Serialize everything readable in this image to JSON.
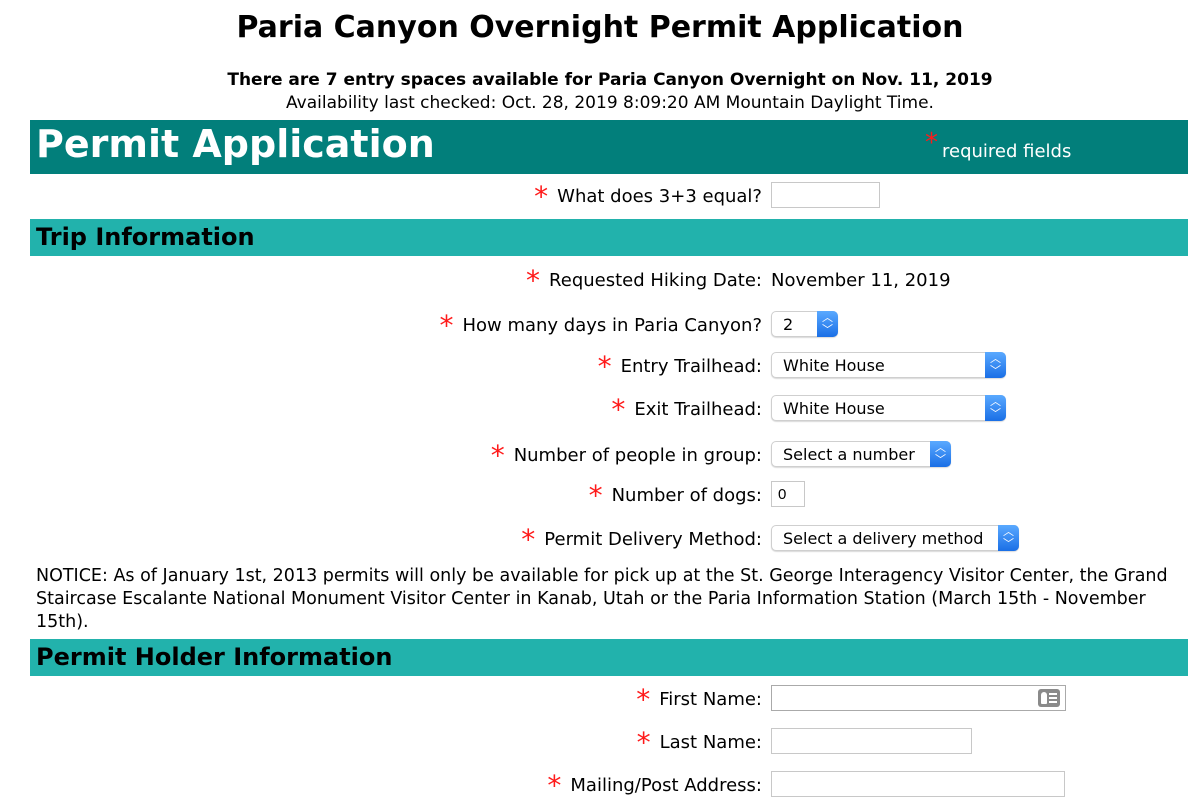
{
  "page": {
    "title": "Paria Canyon Overnight Permit Application",
    "availability": "There are 7 entry spaces available for Paria Canyon Overnight on Nov. 11, 2019",
    "last_checked": "Availability last checked: Oct. 28, 2019 8:09:20 AM Mountain Daylight Time."
  },
  "header": {
    "title": "Permit Application",
    "required_star": "*",
    "required_text": "required fields"
  },
  "captcha": {
    "label": "What does 3+3 equal?",
    "value": ""
  },
  "trip": {
    "title": "Trip Information",
    "hiking_date_label": "Requested Hiking Date:",
    "hiking_date_value": "November 11, 2019",
    "days_label": "How many days in Paria Canyon?",
    "days_value": "2",
    "entry_label": "Entry Trailhead:",
    "entry_value": "White House",
    "exit_label": "Exit Trailhead:",
    "exit_value": "White House",
    "people_label": "Number of people in group:",
    "people_value": "Select a number",
    "dogs_label": "Number of dogs:",
    "dogs_value": "0",
    "delivery_label": "Permit Delivery Method:",
    "delivery_value": "Select a delivery method",
    "notice": "NOTICE: As of January 1st, 2013 permits will only be available for pick up at the St. George Interagency Visitor Center, the Grand Staircase Escalante National Monument Visitor Center in Kanab, Utah or the Paria Information Station (March 15th - November 15th)."
  },
  "holder": {
    "title": "Permit Holder Information",
    "first_name_label": "First Name:",
    "first_name_value": "",
    "last_name_label": "Last Name:",
    "last_name_value": "",
    "address_label": "Mailing/Post Address:",
    "address_value": ""
  },
  "icons": {
    "star": "*",
    "select_arrows": "⌃⌄"
  },
  "colors": {
    "header": "#027f7b",
    "section": "#22b2ac",
    "required": "#ff1a1a",
    "select_accent": "#1a6fe6"
  }
}
